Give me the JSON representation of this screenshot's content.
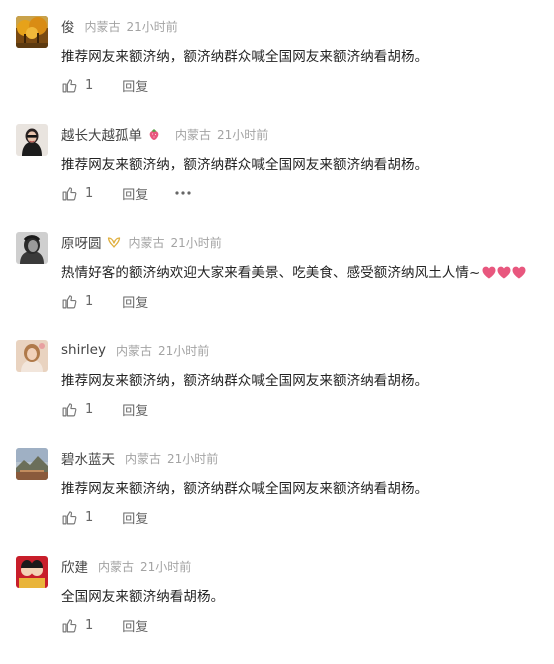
{
  "comments": [
    {
      "username": "俊",
      "location": "内蒙古",
      "time": "21小时前",
      "text": "推荐网友来额济纳，额济纳群众喊全国网友来额济纳看胡杨。",
      "likes": "1",
      "reply": "回复",
      "avatar_icon": "autumn-trees-icon"
    },
    {
      "username": "越长大越孤单",
      "location": "内蒙古",
      "time": "21小时前",
      "text": "推荐网友来额济纳，额济纳群众喊全国网友来额济纳看胡杨。",
      "likes": "1",
      "reply": "回复",
      "avatar_icon": "person-sunglasses-icon",
      "badge_icon": "strawberry-icon",
      "more_icon": "more-dots-icon"
    },
    {
      "username": "原呀圆",
      "location": "内蒙古",
      "time": "21小时前",
      "text": "热情好客的额济纳欢迎大家来看美景、吃美食、感受额济纳风土人情~",
      "likes": "1",
      "reply": "回复",
      "avatar_icon": "portrait-bw-icon",
      "badge_icon": "gold-wings-icon",
      "emoji_icon": "pink-heart-icon"
    },
    {
      "username": "shirley",
      "location": "内蒙古",
      "time": "21小时前",
      "text": "推荐网友来额济纳，额济纳群众喊全国网友来额济纳看胡杨。",
      "likes": "1",
      "reply": "回复",
      "avatar_icon": "girl-portrait-icon"
    },
    {
      "username": "碧水蓝天",
      "location": "内蒙古",
      "time": "21小时前",
      "text": "推荐网友来额济纳，额济纳群众喊全国网友来额济纳看胡杨。",
      "likes": "1",
      "reply": "回复",
      "avatar_icon": "landscape-icon"
    },
    {
      "username": "欣建",
      "location": "内蒙古",
      "time": "21小时前",
      "text": "全国网友来额济纳看胡杨。",
      "likes": "1",
      "reply": "回复",
      "avatar_icon": "red-couple-icon"
    }
  ],
  "colors": {
    "username": "#444444",
    "meta": "#a3a3a3",
    "body_text": "#222222",
    "action": "#666666",
    "heart": "#e8577e"
  }
}
